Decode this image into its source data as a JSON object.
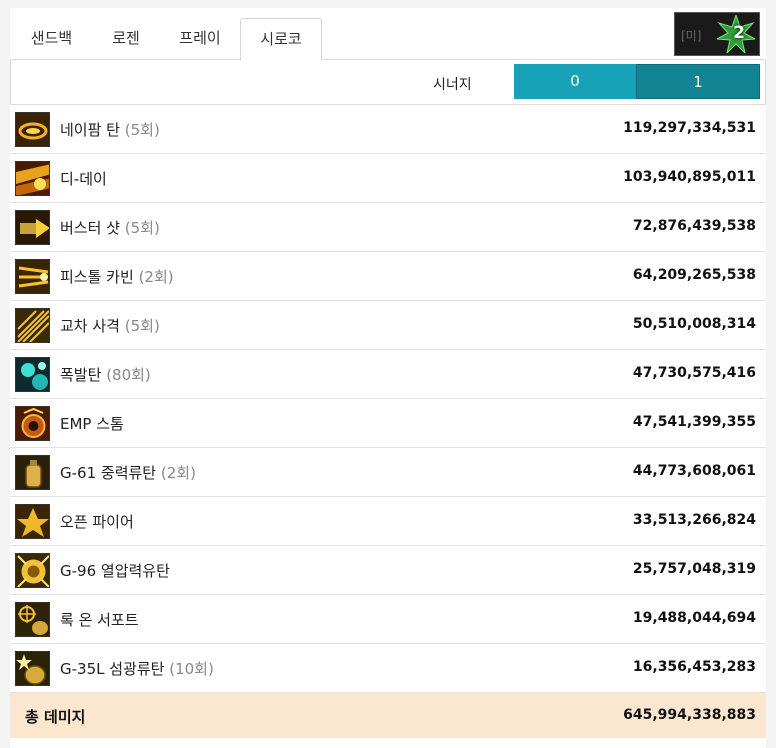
{
  "tabs": [
    {
      "label": "샌드백"
    },
    {
      "label": "로젠"
    },
    {
      "label": "프레이"
    },
    {
      "label": "시로코"
    }
  ],
  "active_tab": 3,
  "thumbnail": {
    "left_text": "[미]",
    "number": "2"
  },
  "synergy": {
    "label": "시너지",
    "options": [
      "0",
      "1"
    ],
    "selected": "1"
  },
  "skills": [
    {
      "name": "네이팜 탄",
      "count": "(5회)",
      "damage": "119,297,334,531",
      "icon": "napalm-icon"
    },
    {
      "name": "디-데이",
      "count": "",
      "damage": "103,940,895,011",
      "icon": "d-day-icon"
    },
    {
      "name": "버스터 샷",
      "count": "(5회)",
      "damage": "72,876,439,538",
      "icon": "buster-shot-icon"
    },
    {
      "name": "피스톨 카빈",
      "count": "(2회)",
      "damage": "64,209,265,538",
      "icon": "pistol-carbine-icon"
    },
    {
      "name": "교차 사격",
      "count": "(5회)",
      "damage": "50,510,008,314",
      "icon": "cross-fire-icon"
    },
    {
      "name": "폭발탄",
      "count": "(80회)",
      "damage": "47,730,575,416",
      "icon": "explosive-bullet-icon"
    },
    {
      "name": "EMP 스톰",
      "count": "",
      "damage": "47,541,399,355",
      "icon": "emp-storm-icon"
    },
    {
      "name": "G-61 중력류탄",
      "count": "(2회)",
      "damage": "44,773,608,061",
      "icon": "gravity-grenade-icon"
    },
    {
      "name": "오픈 파이어",
      "count": "",
      "damage": "33,513,266,824",
      "icon": "open-fire-icon"
    },
    {
      "name": "G-96 열압력유탄",
      "count": "",
      "damage": "25,757,048,319",
      "icon": "thermobaric-grenade-icon"
    },
    {
      "name": "록 온 서포트",
      "count": "",
      "damage": "19,488,044,694",
      "icon": "lock-on-support-icon"
    },
    {
      "name": "G-35L 섬광류탄",
      "count": "(10회)",
      "damage": "16,356,453,283",
      "icon": "flash-grenade-icon"
    }
  ],
  "total": {
    "label": "총 데미지",
    "value": "645,994,338,883"
  },
  "colors": {
    "accent": "#17a2b8",
    "accent_dark": "#128594",
    "total_bg": "#fbe7cf"
  }
}
